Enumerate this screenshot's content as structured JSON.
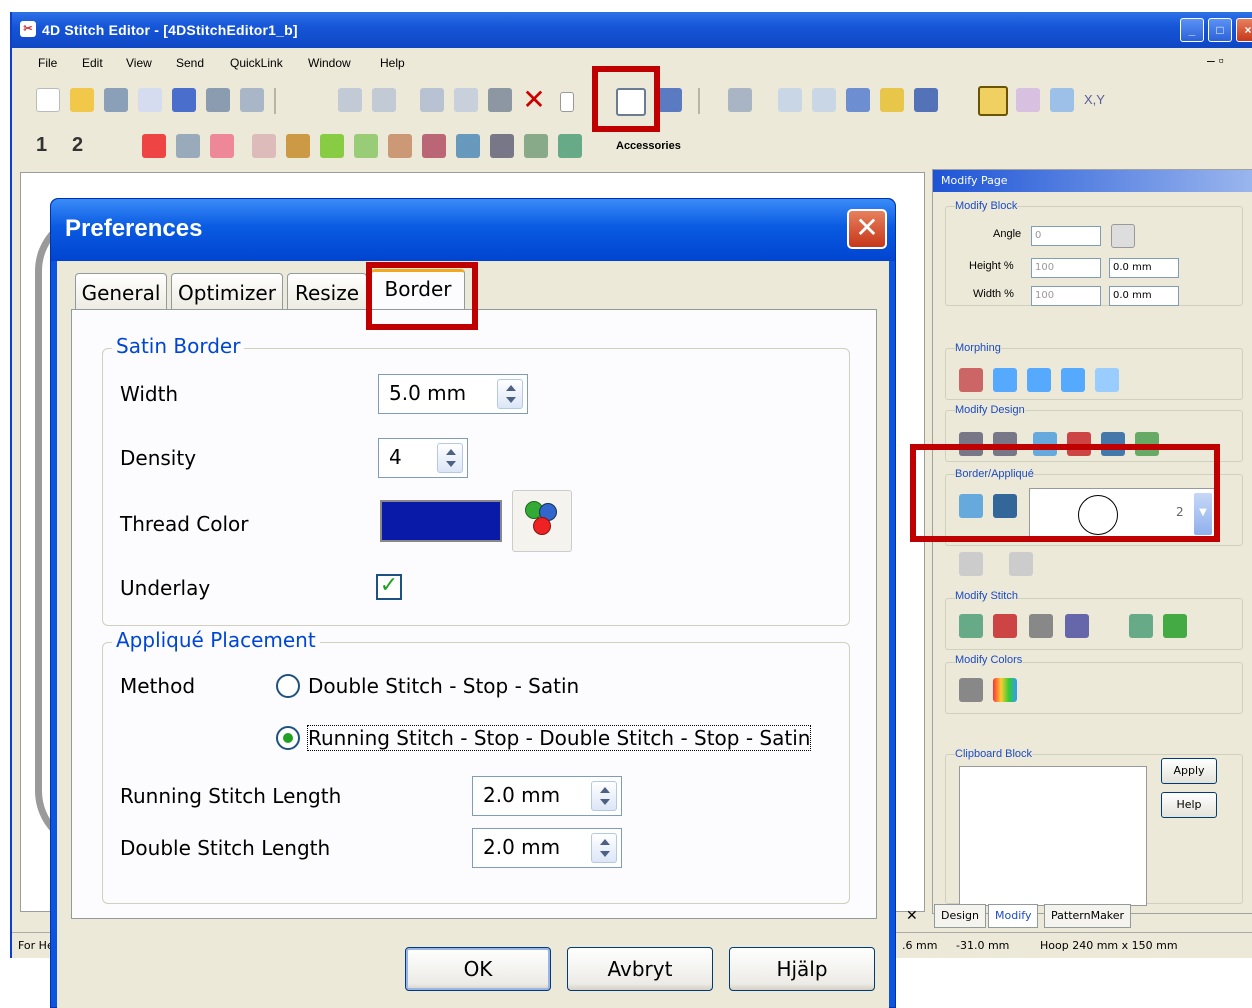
{
  "main_window": {
    "title": "4D Stitch Editor - [4DStitchEditor1_b]",
    "menu": [
      "File",
      "Edit",
      "View",
      "Send",
      "QuickLink",
      "Window",
      "Help"
    ],
    "accessories_label": "Accessories",
    "toolbar2_numbers": [
      "1",
      "2"
    ],
    "xy_label": "X,Y"
  },
  "modify_panel": {
    "title": "Modify Page",
    "modify_block": "Modify Block",
    "angle_label": "Angle",
    "angle_value": "0",
    "height_label": "Height %",
    "height_value": "100",
    "height_mm": "0.0 mm",
    "width_label": "Width %",
    "width_value": "100",
    "width_mm": "0.0 mm",
    "morphing": "Morphing",
    "modify_design": "Modify Design",
    "border_applique": "Border/Appliqué",
    "border_number": "2",
    "modify_stitch": "Modify Stitch",
    "modify_colors": "Modify Colors",
    "clipboard_block": "Clipboard Block",
    "apply": "Apply",
    "help": "Help",
    "tabs": [
      "Design",
      "Modify",
      "PatternMaker"
    ]
  },
  "status_bar": {
    "left": "For Help",
    "x": ".6 mm",
    "y": "-31.0 mm",
    "hoop": "Hoop 240 mm x 150 mm"
  },
  "dialog": {
    "title": "Preferences",
    "tabs": [
      "General",
      "Optimizer",
      "Resize",
      "Border"
    ],
    "active_tab": "Border",
    "satin_border": {
      "legend": "Satin Border",
      "width_label": "Width",
      "width_value": "5.0 mm",
      "density_label": "Density",
      "density_value": "4",
      "thread_color_label": "Thread Color",
      "thread_color": "#0a1aa8",
      "underlay_label": "Underlay",
      "underlay_checked": true
    },
    "applique_placement": {
      "legend": "Appliqué Placement",
      "method_label": "Method",
      "options": [
        "Double Stitch - Stop - Satin",
        "Running Stitch - Stop - Double Stitch - Stop - Satin"
      ],
      "selected_option": 1,
      "running_label": "Running Stitch Length",
      "running_value": "2.0 mm",
      "double_label": "Double Stitch Length",
      "double_value": "2.0 mm"
    },
    "buttons": {
      "ok": "OK",
      "cancel": "Avbryt",
      "help": "Hjälp"
    }
  },
  "colors": {
    "highlight": "#c00000",
    "xp_blue": "#0a55e0",
    "check_green": "#21a121"
  }
}
